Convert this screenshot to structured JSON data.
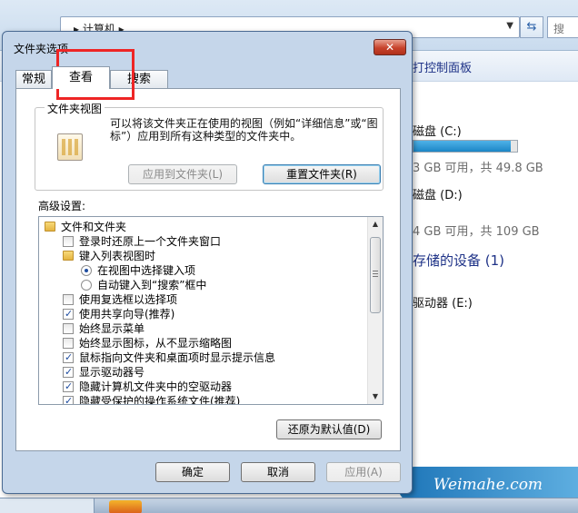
{
  "explorer": {
    "address_text": "▸ 计算机 ▸",
    "search_placeholder": "搜",
    "control_panel": "打控制面板",
    "drives": [
      {
        "name": "磁盘 (C:)",
        "info": "3 GB 可用，共 49.8 GB",
        "used_fraction": 0.94
      },
      {
        "name": "磁盘 (D:)",
        "info": "4 GB 可用，共 109 GB"
      }
    ],
    "removable_section": "存储的设备 (1)",
    "drive_e": "驱动器 (E:)"
  },
  "dialog": {
    "title": "文件夹选项",
    "close_label": "✕",
    "tabs": [
      "常规",
      "查看",
      "搜索"
    ],
    "active_tab": "查看",
    "folder_views": {
      "group_label": "文件夹视图",
      "description": "可以将该文件夹正在使用的视图（例如“详细信息”或“图标”）应用到所有这种类型的文件夹中。",
      "apply_button": "应用到文件夹(L)",
      "reset_button": "重置文件夹(R)"
    },
    "advanced": {
      "label": "高级设置:",
      "items": [
        {
          "type": "folder",
          "text": "文件和文件夹",
          "level": 0
        },
        {
          "type": "checkbox",
          "checked": false,
          "text": "登录时还原上一个文件夹窗口",
          "level": 1
        },
        {
          "type": "folder",
          "text": "键入列表视图时",
          "level": 1
        },
        {
          "type": "radio",
          "checked": true,
          "text": "在视图中选择键入项",
          "level": 2
        },
        {
          "type": "radio",
          "checked": false,
          "text": "自动键入到“搜索”框中",
          "level": 2
        },
        {
          "type": "checkbox",
          "checked": false,
          "text": "使用复选框以选择项",
          "level": 1
        },
        {
          "type": "checkbox",
          "checked": true,
          "text": "使用共享向导(推荐)",
          "level": 1
        },
        {
          "type": "checkbox",
          "checked": false,
          "text": "始终显示菜单",
          "level": 1
        },
        {
          "type": "checkbox",
          "checked": false,
          "text": "始终显示图标，从不显示缩略图",
          "level": 1
        },
        {
          "type": "checkbox",
          "checked": true,
          "text": "鼠标指向文件夹和桌面项时显示提示信息",
          "level": 1
        },
        {
          "type": "checkbox",
          "checked": true,
          "text": "显示驱动器号",
          "level": 1
        },
        {
          "type": "checkbox",
          "checked": true,
          "text": "隐藏计算机文件夹中的空驱动器",
          "level": 1
        },
        {
          "type": "checkbox",
          "checked": true,
          "text": "隐藏受保护的操作系统文件(推荐)",
          "level": 1
        }
      ],
      "restore_button": "还原为默认值(D)"
    },
    "ok_button": "确定",
    "cancel_button": "取消",
    "apply_button": "应用(A)"
  },
  "watermark": "Weimahe.com",
  "colors": {
    "highlight": "#ee2525",
    "link": "#1e3287",
    "dialog_bg": "#c5d6ea"
  }
}
